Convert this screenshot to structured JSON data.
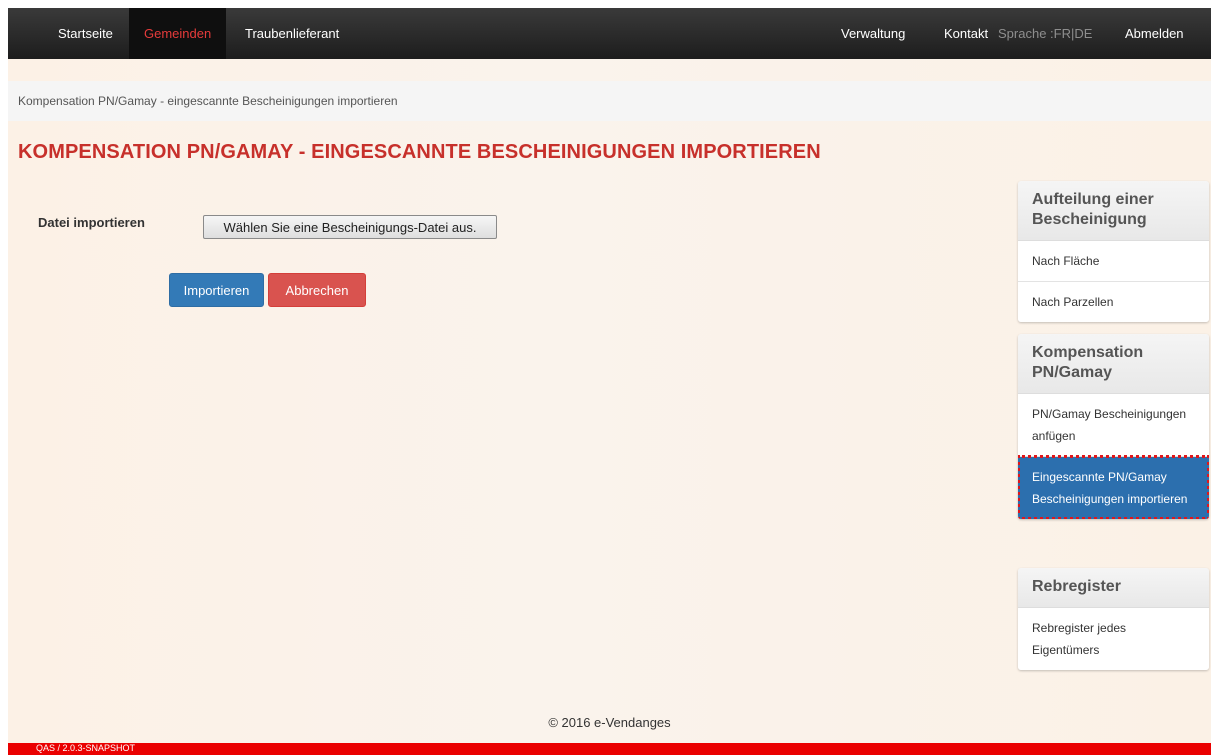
{
  "nav": {
    "home": "Startseite",
    "municipalities": "Gemeinden",
    "supplier": "Traubenlieferant",
    "admin": "Verwaltung",
    "contact": "Kontakt",
    "language": "Sprache :FR|DE",
    "logout": "Abmelden"
  },
  "breadcrumb": "Kompensation PN/Gamay - eingescannte Bescheinigungen importieren",
  "page_title": "KOMPENSATION PN/GAMAY - EINGESCANNTE BESCHEINIGUNGEN IMPORTIEREN",
  "form": {
    "file_label": "Datei importieren",
    "file_button": "Wählen Sie eine Bescheinigungs-Datei aus.",
    "import_button": "Importieren",
    "cancel_button": "Abbrechen"
  },
  "sidebar": [
    {
      "heading": "Aufteilung einer Bescheinigung",
      "items": [
        "Nach Fläche",
        "Nach Parzellen"
      ]
    },
    {
      "heading": "Kompensation PN/Gamay",
      "items": [
        "PN/Gamay Bescheinigungen anfügen",
        "Eingescannte PN/Gamay Bescheinigungen importieren"
      ]
    },
    {
      "heading": "Rebregister",
      "items": [
        "Rebregister jedes Eigentümers"
      ]
    }
  ],
  "footer": "© 2016 e-Vendanges",
  "version": "QAS / 2.0.3-SNAPSHOT",
  "colors": {
    "title_red": "#c7302b",
    "active_nav": "#e63b3b",
    "primary": "#337ab7",
    "danger": "#d9534f",
    "sidebar_active": "#2c6fae",
    "version_bar": "#ea0000"
  }
}
